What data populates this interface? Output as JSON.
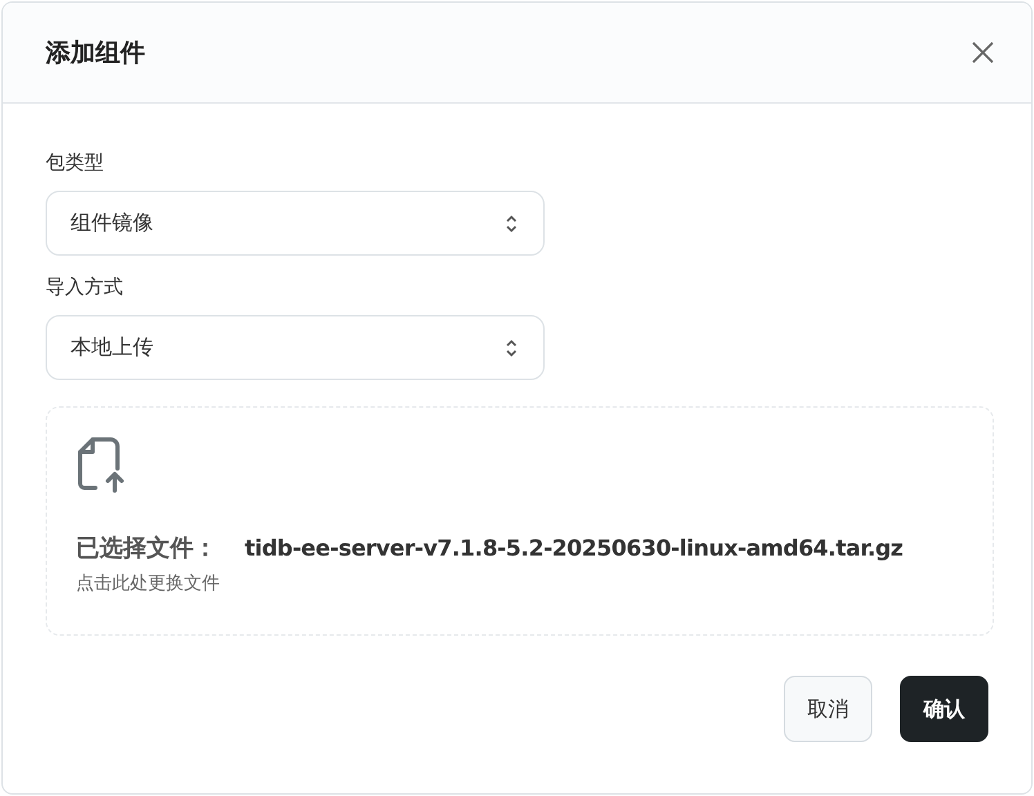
{
  "dialog": {
    "title": "添加组件"
  },
  "fields": [
    {
      "label": "包类型",
      "value": "组件镜像"
    },
    {
      "label": "导入方式",
      "value": "本地上传"
    }
  ],
  "upload": {
    "selected_label": "已选择文件：",
    "file_name": "tidb-ee-server-v7.1.8-5.2-20250630-linux-amd64.tar.gz",
    "hint": "点击此处更换文件"
  },
  "buttons": [
    {
      "label": "取消",
      "kind": "secondary"
    },
    {
      "label": "确认",
      "kind": "primary"
    }
  ]
}
